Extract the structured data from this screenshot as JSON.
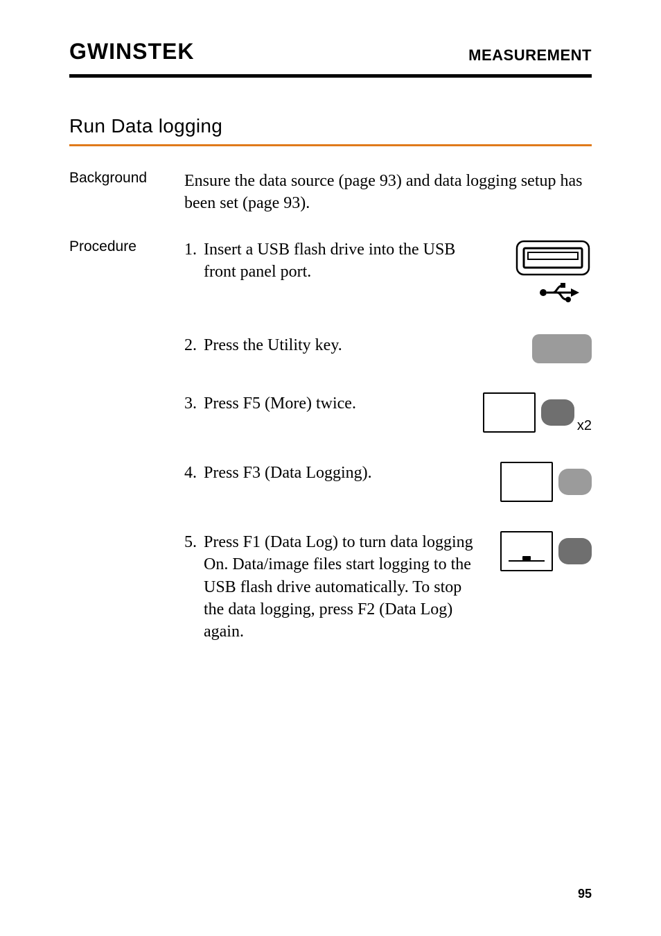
{
  "header": {
    "brand": "GWINSTEK",
    "section": "MEASUREMENT"
  },
  "title": "Run Data logging",
  "background": {
    "label": "Background",
    "text": "Ensure the data source (page 93) and data logging setup has been set (page 93)."
  },
  "procedure": {
    "label": "Procedure",
    "items": [
      {
        "num": "1.",
        "text": "Insert a USB flash drive into the USB front panel port."
      },
      {
        "num": "2.",
        "text": "Press the Utility key."
      },
      {
        "num": "3.",
        "text": "Press F5 (More) twice.",
        "suffix": "x2"
      },
      {
        "num": "4.",
        "text": "Press F3 (Data Logging)."
      },
      {
        "num": "5.",
        "text": "Press F1 (Data Log) to turn data logging On. Data/image files start logging to the USB flash drive automatically. To stop the data logging, press F2 (Data Log) again."
      }
    ]
  },
  "pageNumber": "95"
}
